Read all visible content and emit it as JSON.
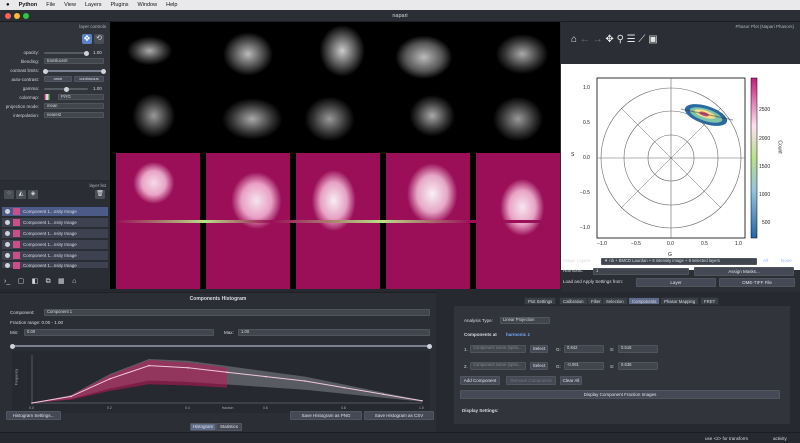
{
  "menubar": {
    "app": "Python",
    "items": [
      "File",
      "View",
      "Layers",
      "Plugins",
      "Window",
      "Help"
    ]
  },
  "window": {
    "title": "napari"
  },
  "layer_controls": {
    "header": "layer controls",
    "opacity": "1.00",
    "gamma": "1.00",
    "rows": [
      {
        "label": "opacity:"
      },
      {
        "label": "blending:",
        "value": "translucent"
      },
      {
        "label": "contrast limits:"
      },
      {
        "label": "auto-contrast:",
        "a": "once",
        "b": "continuous"
      },
      {
        "label": "gamma:"
      },
      {
        "label": "colormap:",
        "value": "PiYG"
      },
      {
        "label": "projection mode:",
        "value": "mean"
      },
      {
        "label": "interpolation:",
        "value": "nearest"
      }
    ]
  },
  "layer_list": {
    "header": "layer list",
    "items": [
      "Component 1...nsity Image",
      "Component 1...nsity Image",
      "Component 1...nsity Image",
      "Component 1...nsity Image",
      "Component 1...nsity Image",
      "Component 1...nsity Image"
    ]
  },
  "phasor": {
    "header": "Phasor Plot (Napari Phasors)",
    "ylabel": "S",
    "xlabel": "G",
    "cbar_label": "Count",
    "xticks": [
      "−1.0",
      "−0.5",
      "0.0",
      "0.5",
      "1.0"
    ],
    "yticks": [
      "1.0",
      "0.5",
      "0.0",
      "−0.5",
      "−1.0"
    ],
    "cticks": [
      "2500",
      "2000",
      "1500",
      "1000",
      "500"
    ],
    "image_layers_label": "Image Layers:",
    "image_layers_value": "▼ nb + BMCD Laurdan + 6 intensity image + 9 selected layers",
    "all": "All",
    "none": "None",
    "harmonic_label": "Harmonic:",
    "harmonic_value": "1",
    "assign_masks": "Assign Masks...",
    "load_label": "Load and Apply Settings from:",
    "layer_btn": "Layer",
    "tiff_btn": "OME-TIFF File",
    "tabs": [
      "Plot Settings",
      "Calibration",
      "Filter",
      "Selection",
      "Components",
      "Phasor Mapping",
      "FRET"
    ]
  },
  "histogram": {
    "title": "Components Histogram",
    "component_label": "Component:",
    "component_value": "Component 1",
    "fraction_range": "Fraction range: 0.00 - 1.00",
    "min_label": "Min:",
    "min_value": "0.00",
    "max_label": "Max:",
    "max_value": "1.00",
    "xlabel": "fraction",
    "ylabel": "Frequency",
    "settings_btn": "Histogram Settings...",
    "save_png": "Save Histogram as PNG",
    "save_csv": "Save Histogram as CSV",
    "tabs": [
      "Histogram",
      "Statistics"
    ],
    "chart_data": {
      "type": "area",
      "x": [
        0,
        0.1,
        0.2,
        0.3,
        0.4,
        0.5,
        0.6,
        0.7,
        0.8,
        0.9,
        1.0
      ],
      "series": [
        {
          "values": [
            0,
            0.15,
            0.55,
            0.85,
            0.8,
            0.7,
            0.6,
            0.5,
            0.35,
            0.2,
            0.05
          ]
        }
      ],
      "xticks": [
        "0.0",
        "0.2",
        "0.4",
        "0.6",
        "0.8",
        "1.0"
      ],
      "ylim": [
        0,
        1
      ]
    }
  },
  "components": {
    "analysis_label": "Analysis Type:",
    "analysis_value": "Linear Projection",
    "heading": "Components at",
    "harmonic_link": "harmonic 1",
    "rows": [
      {
        "num": "1.",
        "placeholder": "Component name (optio...",
        "select": "Select",
        "g_label": "G:",
        "g": "0.842",
        "s_label": "S:",
        "s": "0.516"
      },
      {
        "num": "2.",
        "placeholder": "Component name (optio...",
        "select": "Select",
        "g_label": "G:",
        "g": "-0.081",
        "s_label": "S:",
        "s": "0.638"
      }
    ],
    "add": "Add Component",
    "remove": "Remove Component",
    "clear": "Clear All",
    "display_btn": "Display Component Fraction Images",
    "display_settings": "Display Settings:"
  },
  "status": {
    "hint": "use <2> for transform",
    "activity": "activity"
  }
}
